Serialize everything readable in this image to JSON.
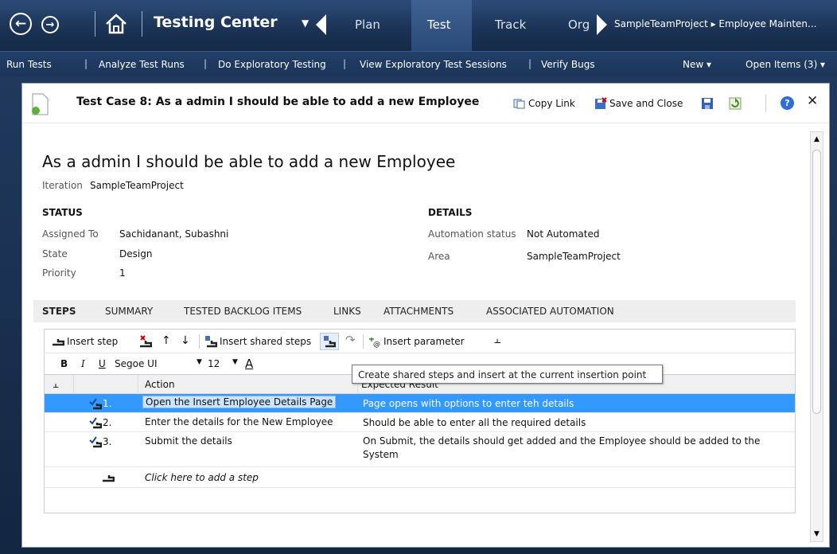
{
  "topbar": {
    "app_title": "Testing Center",
    "hubs": [
      "Plan",
      "Test",
      "Track",
      "Org"
    ],
    "active_hub": "Test",
    "project_path": "SampleTeamProject ▸ Employee Mainten..."
  },
  "subbar": {
    "items": [
      "Run Tests",
      "Analyze Test Runs",
      "Do Exploratory Testing",
      "View Exploratory Test Sessions",
      "Verify Bugs"
    ],
    "new_label": "New ▾",
    "open_items_label": "Open Items (3) ▾"
  },
  "window": {
    "title": "Test Case 8: As a admin I should be able to add a new Employee",
    "copy_link": "Copy Link",
    "save_close": "Save and Close"
  },
  "form": {
    "heading": "As a admin I should be able to add a new Employee",
    "iteration_label": "Iteration",
    "iteration_value": "SampleTeamProject",
    "status_header": "STATUS",
    "details_header": "DETAILS",
    "assigned_label": "Assigned To",
    "assigned_value": "Sachidanant, Subashni",
    "state_label": "State",
    "state_value": "Design",
    "priority_label": "Priority",
    "priority_value": "1",
    "automation_label": "Automation status",
    "automation_value": "Not Automated",
    "area_label": "Area",
    "area_value": "SampleTeamProject"
  },
  "tabs": [
    "STEPS",
    "SUMMARY",
    "TESTED BACKLOG ITEMS",
    "LINKS",
    "ATTACHMENTS",
    "ASSOCIATED AUTOMATION"
  ],
  "toolbar": {
    "insert_step": "Insert step",
    "insert_shared": "Insert shared steps",
    "insert_param": "Insert parameter",
    "bold": "B",
    "italic": "I",
    "underline": "U",
    "font": "Segoe UI",
    "size": "12",
    "font_color": "A",
    "tooltip": "Create shared steps and insert at the current insertion point"
  },
  "grid": {
    "col_action": "Action",
    "col_expected": "Expected Result",
    "rows": [
      {
        "num": "1.",
        "action": "Open the Insert Employee Details Page",
        "expected": "Page opens with options to enter teh details"
      },
      {
        "num": "2.",
        "action": "Enter the details for the New Employee",
        "expected": "Should be able to enter all the required details"
      },
      {
        "num": "3.",
        "action": "Submit the details",
        "expected": "On Submit, the details should get added and the Employee should be added to the System"
      }
    ],
    "add_step": "Click here to add a step"
  },
  "colors": {
    "accent": "#3399ff",
    "topbar": "#1a3254"
  }
}
